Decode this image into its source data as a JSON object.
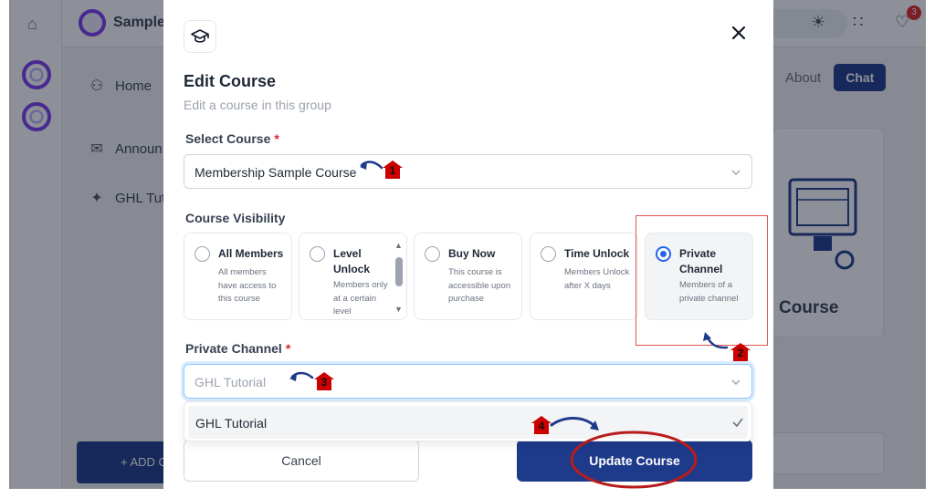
{
  "background": {
    "brand_name": "Sample",
    "nav": [
      {
        "label": "Home",
        "icon": "users-icon"
      },
      {
        "label": "Announ",
        "icon": "megaphone-icon"
      },
      {
        "label": "GHL Tut",
        "icon": "sparkle-icon"
      }
    ],
    "add_button": "+ ADD C",
    "tabs": {
      "about": "About",
      "chat": "Chat"
    },
    "notification_count": "3",
    "card_title": "Course"
  },
  "modal": {
    "title": "Edit Course",
    "subtitle": "Edit a course in this group",
    "select_course": {
      "label": "Select Course",
      "required_mark": "*",
      "value": "Membership Sample Course"
    },
    "visibility": {
      "label": "Course Visibility",
      "options": [
        {
          "title": "All Members",
          "desc": "All members have access to this course",
          "selected": false
        },
        {
          "title": "Level Unlock",
          "desc": "Members only at a certain level",
          "selected": false
        },
        {
          "title": "Buy Now",
          "desc": "This course is accessible upon purchase",
          "selected": false
        },
        {
          "title": "Time Unlock",
          "desc": "Members Unlock after X days",
          "selected": false
        },
        {
          "title": "Private Channel",
          "desc": "Members of a private channel",
          "selected": true
        }
      ]
    },
    "private_channel": {
      "label": "Private Channel",
      "required_mark": "*",
      "placeholder": "GHL Tutorial",
      "dropdown_item": "GHL Tutorial"
    },
    "buttons": {
      "cancel": "Cancel",
      "update": "Update Course"
    }
  },
  "annotations": {
    "steps": [
      "1",
      "2",
      "3",
      "4"
    ],
    "color": "#cc0000",
    "arrow_color": "#1e3a8a"
  },
  "colors": {
    "primary": "#1e3a8a",
    "radio_selected": "#2563eb",
    "required": "#dc2626",
    "brand": "#7c3aed"
  }
}
